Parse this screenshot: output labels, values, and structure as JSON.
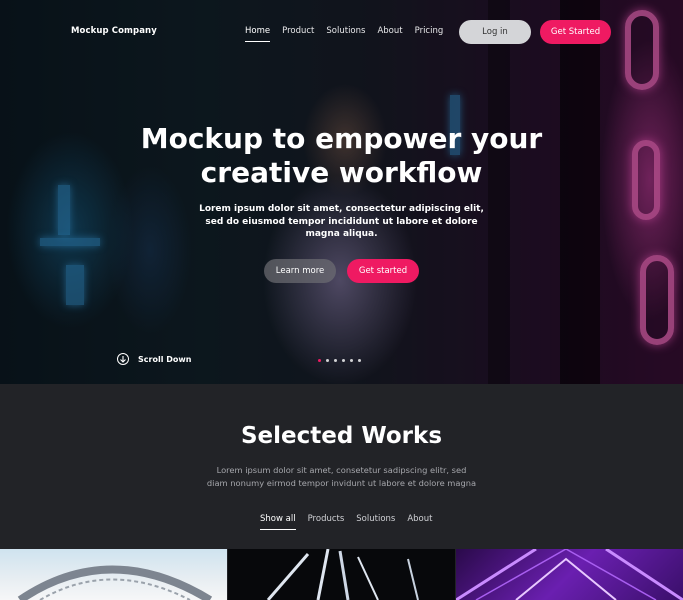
{
  "header": {
    "logo": "Mockup Company",
    "nav": [
      "Home",
      "Product",
      "Solutions",
      "About",
      "Pricing"
    ],
    "login_label": "Log in",
    "cta_label": "Get Started"
  },
  "hero": {
    "title_line1": "Mockup to empower your",
    "title_line2": "creative workflow",
    "subtitle": "Lorem ipsum dolor sit amet, consectetur adipiscing elit, sed do eiusmod tempor incididunt ut labore et dolore magna aliqua.",
    "learn_more": "Learn more",
    "get_started": "Get started",
    "scroll_label": "Scroll Down",
    "slides_total": 6,
    "slide_active": 1
  },
  "works": {
    "title": "Selected Works",
    "subtitle": "Lorem ipsum dolor sit amet, consetetur sadipscing elitr, sed diam nonumy eirmod tempor invidunt ut labore et dolore magna",
    "filters": [
      "Show all",
      "Products",
      "Solutions",
      "About"
    ]
  },
  "colors": {
    "accent": "#ef1a62",
    "section_bg": "#222327",
    "login_bg": "#d4d5d8"
  }
}
